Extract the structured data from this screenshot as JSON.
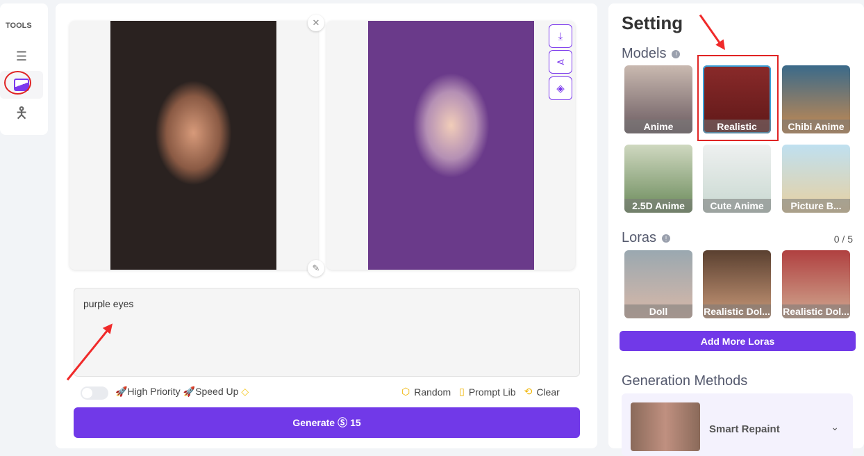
{
  "tools": {
    "title": "TOOLS",
    "items": [
      {
        "icon": "text-list-icon"
      },
      {
        "icon": "image-icon",
        "active": true
      },
      {
        "icon": "person-pose-icon"
      }
    ]
  },
  "editor": {
    "prompt": "purple eyes",
    "high_priority": "🚀High Priority",
    "speed_up": "🚀Speed Up",
    "random": "Random",
    "prompt_lib": "Prompt Lib",
    "clear": "Clear",
    "generate": "Generate",
    "cost": "15",
    "accent": "#7139e8"
  },
  "settings": {
    "title": "Setting",
    "models_title": "Models",
    "models": [
      {
        "label": "Anime"
      },
      {
        "label": "Realistic",
        "selected": true
      },
      {
        "label": "Chibi Anime"
      },
      {
        "label": "2.5D Anime",
        "premium": true
      },
      {
        "label": "Cute Anime",
        "premium": true
      },
      {
        "label": "Picture B...",
        "premium": true
      }
    ],
    "loras_title": "Loras",
    "loras_count": "0 / 5",
    "loras": [
      {
        "label": "Doll"
      },
      {
        "label": "Realistic Dol..."
      },
      {
        "label": "Realistic Dol..."
      }
    ],
    "add_loras": "Add More Loras",
    "methods_title": "Generation Methods",
    "method": "Smart Repaint"
  }
}
